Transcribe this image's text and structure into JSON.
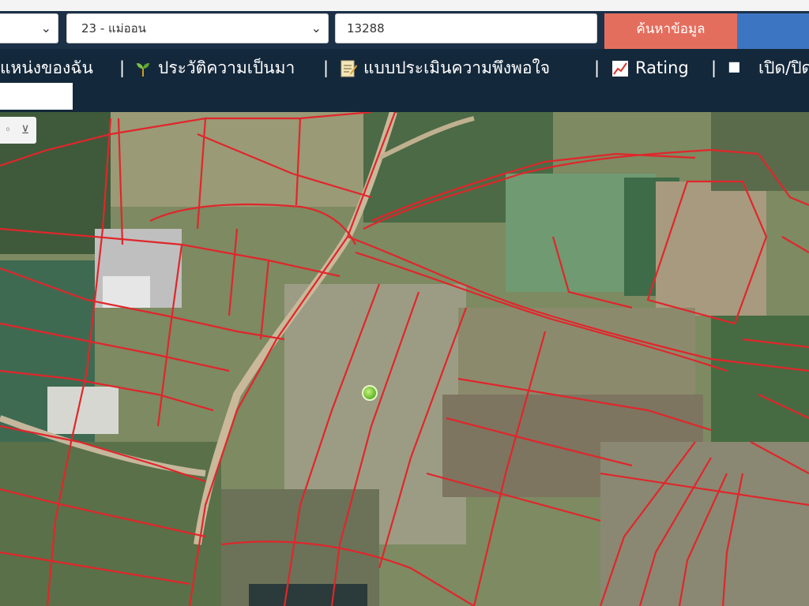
{
  "search": {
    "province_value": "",
    "district_value": "23 - แม่ออน",
    "parcel_value": "13288",
    "search_label": "ค้นหาข้อมูล"
  },
  "nav": {
    "items": [
      {
        "label": "แหน่งของฉัน",
        "icon": ""
      },
      {
        "label": "ประวัติความเป็นมา",
        "icon": "sprout-icon"
      },
      {
        "label": "แบบประเมินความพึงพอใจ",
        "icon": "memo-icon"
      },
      {
        "label": "Rating",
        "icon": "chart-icon"
      },
      {
        "label": "เปิด/ปิด",
        "icon": "checkbox-icon"
      }
    ],
    "separator": "|"
  },
  "colors": {
    "navbar": "#14283b",
    "search_button": "#e46e5e",
    "accent_blue": "#3c76c3",
    "parcel_lines": "#e0262b",
    "marker": "#5db52b"
  }
}
